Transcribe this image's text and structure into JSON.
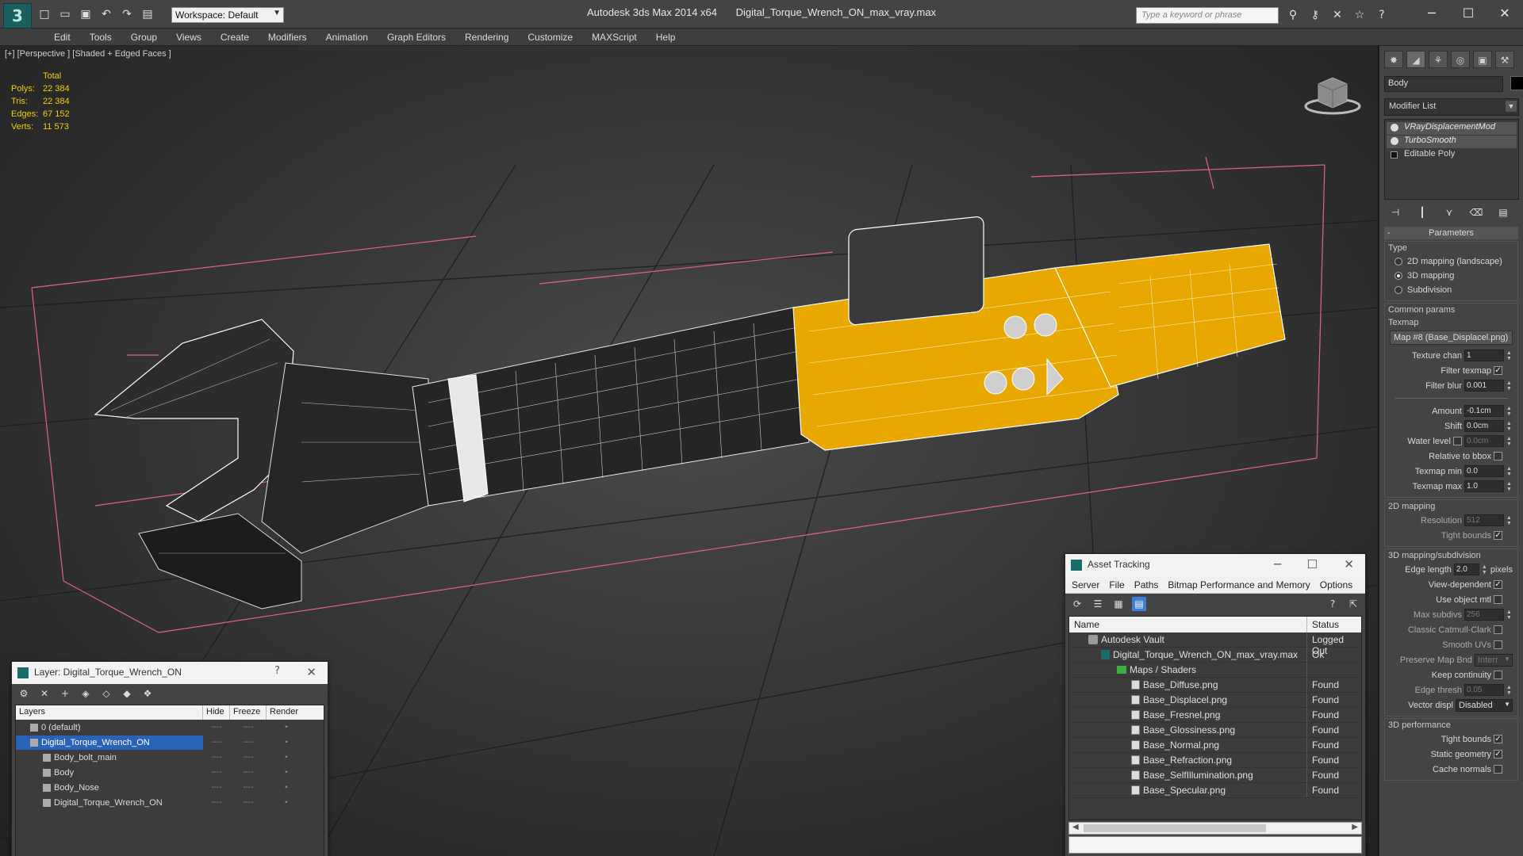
{
  "app": {
    "title": "Autodesk 3ds Max  2014 x64",
    "file": "Digital_Torque_Wrench_ON_max_vray.max",
    "workspace": "Workspace: Default",
    "search_placeholder": "Type a keyword or phrase"
  },
  "menu": [
    "Edit",
    "Tools",
    "Group",
    "Views",
    "Create",
    "Modifiers",
    "Animation",
    "Graph Editors",
    "Rendering",
    "Customize",
    "MAXScript",
    "Help"
  ],
  "viewport": {
    "label": "[+] [Perspective ] [Shaded + Edged Faces ]",
    "stats": {
      "header": "Total",
      "rows": [
        {
          "label": "Polys:",
          "value": "22 384"
        },
        {
          "label": "Tris:",
          "value": "22 384"
        },
        {
          "label": "Edges:",
          "value": "67 152"
        },
        {
          "label": "Verts:",
          "value": "11 573"
        }
      ]
    }
  },
  "command_panel": {
    "object_name": "Body",
    "modifier_list": "Modifier List",
    "stack": [
      "VRayDisplacementMod",
      "TurboSmooth",
      "Editable Poly"
    ],
    "rollout": "Parameters",
    "type_group": "Type",
    "type_options": [
      "2D mapping (landscape)",
      "3D mapping",
      "Subdivision"
    ],
    "type_selected": 1,
    "common_group": "Common params",
    "texmap_label": "Texmap",
    "texmap_value": "Map #8 (Base_Displacel.png)",
    "texture_chan_label": "Texture chan",
    "texture_chan": "1",
    "filter_texmap_label": "Filter texmap",
    "filter_blur_label": "Filter blur",
    "filter_blur": "0.001",
    "amount_label": "Amount",
    "amount": "-0.1cm",
    "shift_label": "Shift",
    "shift": "0.0cm",
    "water_level_label": "Water level",
    "water_level": "0.0cm",
    "relative_bbox_label": "Relative to bbox",
    "texmap_min_label": "Texmap min",
    "texmap_min": "0.0",
    "texmap_max_label": "Texmap max",
    "texmap_max": "1.0",
    "mapping2d_group": "2D mapping",
    "resolution_label": "Resolution",
    "resolution": "512",
    "tight_bounds_label": "Tight bounds",
    "mapping3d_group": "3D mapping/subdivision",
    "edge_length_label": "Edge length",
    "edge_length": "2.0",
    "pixels_label": "pixels",
    "view_dependent_label": "View-dependent",
    "use_object_mtl_label": "Use object mtl",
    "max_subdivs_label": "Max subdivs",
    "max_subdivs": "256",
    "catmull_label": "Classic Catmull-Clark",
    "smooth_uvs_label": "Smooth UVs",
    "preserve_label": "Preserve Map Bnd",
    "preserve_value": "Interr",
    "keep_continuity_label": "Keep continuity",
    "edge_thresh_label": "Edge thresh",
    "edge_thresh": "0.05",
    "vector_disp_label": "Vector displ",
    "vector_disp": "Disabled",
    "performance_group": "3D performance",
    "perf_tight_label": "Tight bounds",
    "static_geo_label": "Static geometry",
    "cache_normals_label": "Cache normals"
  },
  "asset_tracking": {
    "title": "Asset Tracking",
    "menu": [
      "Server",
      "File",
      "Paths",
      "Bitmap Performance and Memory",
      "Options"
    ],
    "columns": [
      "Name",
      "Status"
    ],
    "rows": [
      {
        "name": "Autodesk Vault",
        "status": "Logged Out",
        "indent": 1,
        "icon": "vault"
      },
      {
        "name": "Digital_Torque_Wrench_ON_max_vray.max",
        "status": "Ok",
        "indent": 2,
        "icon": "max"
      },
      {
        "name": "Maps / Shaders",
        "status": "",
        "indent": 3,
        "icon": "folder"
      },
      {
        "name": "Base_Diffuse.png",
        "status": "Found",
        "indent": 4,
        "icon": "file"
      },
      {
        "name": "Base_Displacel.png",
        "status": "Found",
        "indent": 4,
        "icon": "file"
      },
      {
        "name": "Base_Fresnel.png",
        "status": "Found",
        "indent": 4,
        "icon": "file"
      },
      {
        "name": "Base_Glossiness.png",
        "status": "Found",
        "indent": 4,
        "icon": "file"
      },
      {
        "name": "Base_Normal.png",
        "status": "Found",
        "indent": 4,
        "icon": "file"
      },
      {
        "name": "Base_Refraction.png",
        "status": "Found",
        "indent": 4,
        "icon": "file"
      },
      {
        "name": "Base_SelfIllumination.png",
        "status": "Found",
        "indent": 4,
        "icon": "file"
      },
      {
        "name": "Base_Specular.png",
        "status": "Found",
        "indent": 4,
        "icon": "file"
      }
    ]
  },
  "layer_window": {
    "title": "Layer: Digital_Torque_Wrench_ON",
    "help": "?",
    "columns": [
      "Layers",
      "Hide",
      "Freeze",
      "Render"
    ],
    "rows": [
      {
        "name": "0 (default)",
        "indent": 1,
        "selected": false
      },
      {
        "name": "Digital_Torque_Wrench_ON",
        "indent": 1,
        "selected": true
      },
      {
        "name": "Body_bolt_main",
        "indent": 2,
        "selected": false
      },
      {
        "name": "Body",
        "indent": 2,
        "selected": false
      },
      {
        "name": "Body_Nose",
        "indent": 2,
        "selected": false
      },
      {
        "name": "Digital_Torque_Wrench_ON",
        "indent": 2,
        "selected": false
      }
    ],
    "dash": "----"
  },
  "colors": {
    "accent_yellow": "#e8a800",
    "selection_blue": "#2a62b8",
    "grid_pink": "#e0609a"
  }
}
